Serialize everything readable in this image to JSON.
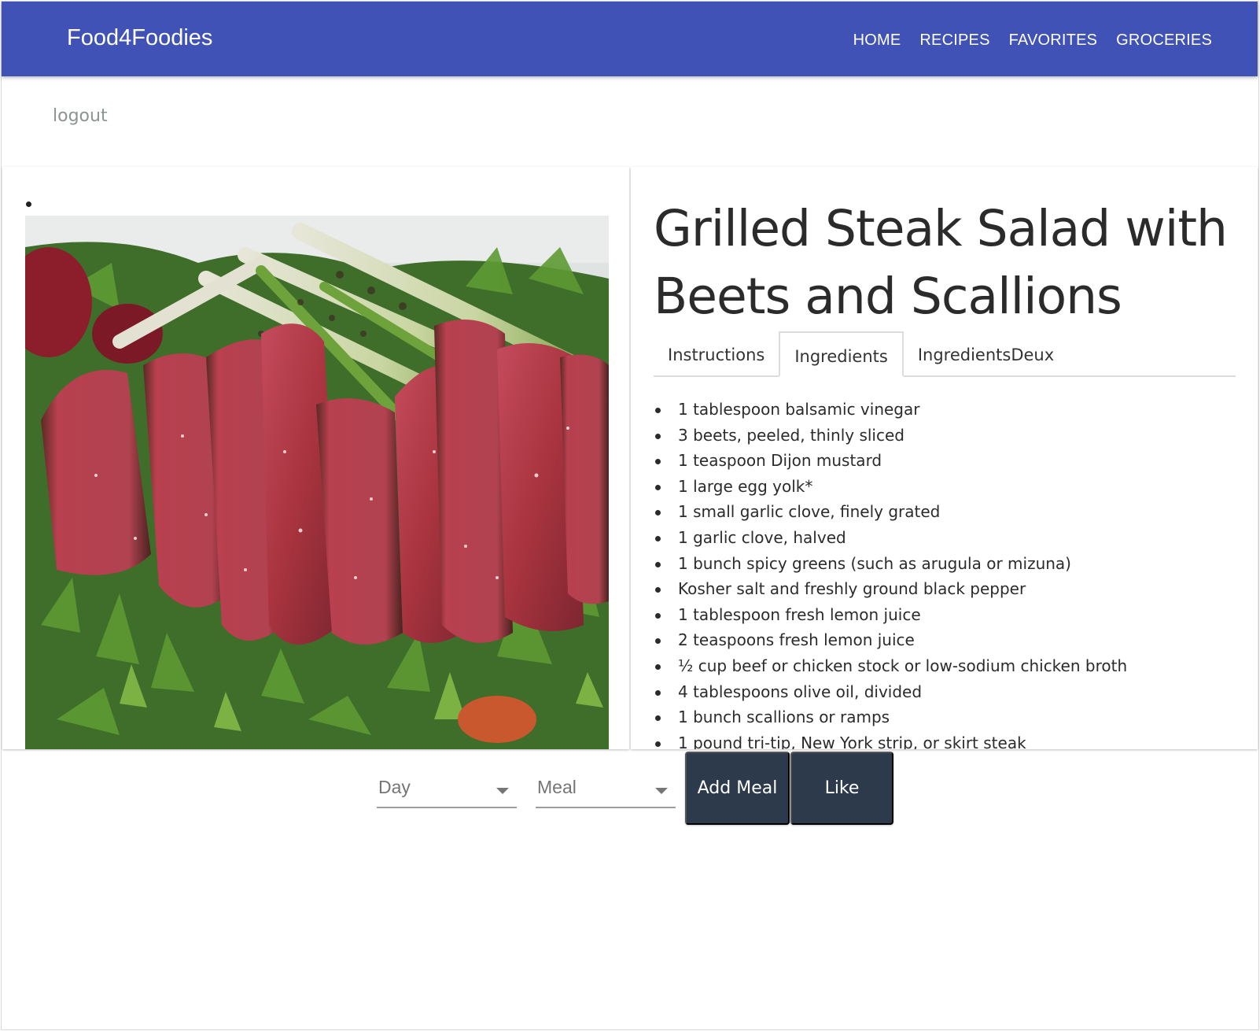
{
  "navbar": {
    "brand": "Food4Foodies",
    "links": [
      "HOME",
      "RECIPES",
      "FAVORITES",
      "GROCERIES"
    ],
    "color": "#4052b5"
  },
  "logout_label": "logout",
  "recipe": {
    "title": "Grilled Steak Salad with Beets and Scallions",
    "image_icon": "steak-salad-photo"
  },
  "tabs": [
    {
      "label": "Instructions",
      "active": false
    },
    {
      "label": "Ingredients",
      "active": true
    },
    {
      "label": "IngredientsDeux",
      "active": false
    }
  ],
  "ingredients": [
    "1 tablespoon balsamic vinegar",
    "3 beets, peeled, thinly sliced",
    "1 teaspoon Dijon mustard",
    "1 large egg yolk*",
    "1 small garlic clove, finely grated",
    "1 garlic clove, halved",
    "1 bunch spicy greens (such as arugula or mizuna)",
    "Kosher salt and freshly ground black pepper",
    "1 tablespoon fresh lemon juice",
    "2 teaspoons fresh lemon juice",
    "½ cup beef or chicken stock or low-sodium chicken broth",
    "4 tablespoons olive oil, divided",
    "1 bunch scallions or ramps",
    "1 pound tri-tip, New York strip, or skirt steak"
  ],
  "controls": {
    "day_label": "Day",
    "meal_label": "Meal",
    "add_meal_label": "Add Meal",
    "like_label": "Like",
    "button_color": "#2c3a4c"
  }
}
